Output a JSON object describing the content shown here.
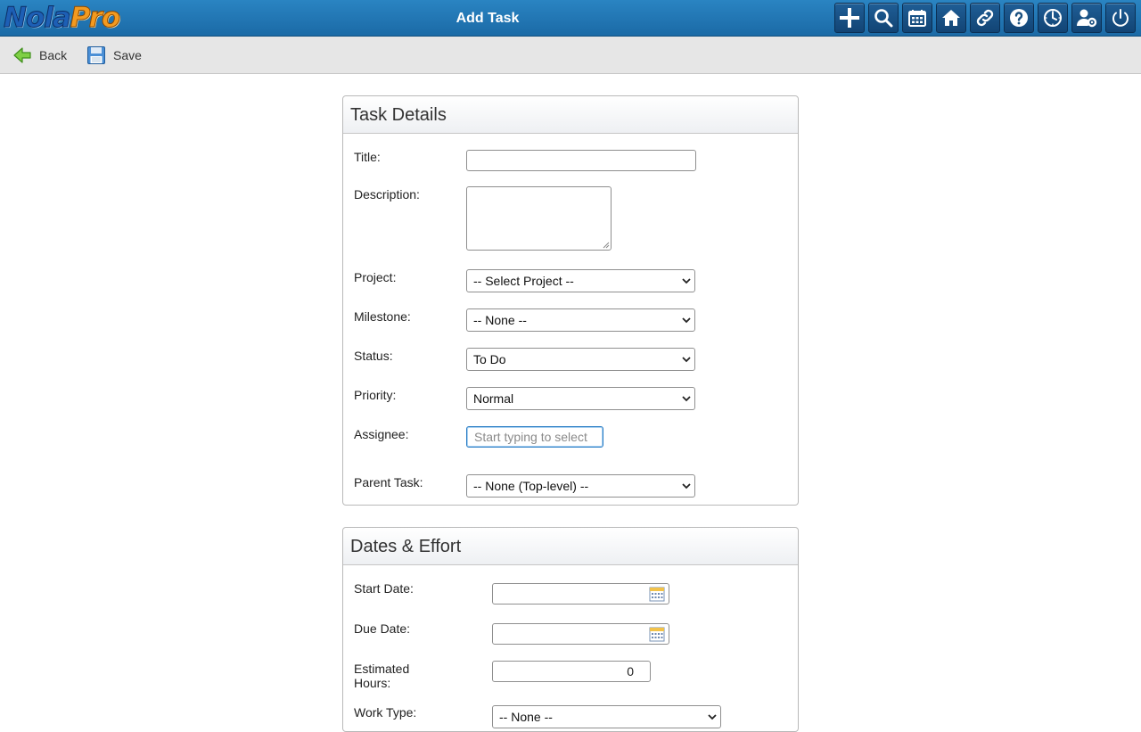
{
  "app": {
    "logo_part1": "Nola",
    "logo_part2": "Pro",
    "title": "Add Task"
  },
  "topbar_icons": [
    "add-icon",
    "search-icon",
    "calendar-icon",
    "home-icon",
    "link-icon",
    "help-icon",
    "clock-icon",
    "user-settings-icon",
    "power-icon"
  ],
  "toolbar": {
    "back_label": "Back",
    "save_label": "Save"
  },
  "task_details": {
    "heading": "Task Details",
    "title_label": "Title:",
    "title_value": "",
    "description_label": "Description:",
    "project_label": "Project:",
    "project_value": "-- Select Project --",
    "milestone_label": "Milestone:",
    "milestone_value": "-- None --",
    "status_label": "Status:",
    "status_value": "To Do",
    "priority_label": "Priority:",
    "priority_value": "Normal",
    "assignee_label": "Assignee:",
    "assignee_placeholder": "Start typing to select",
    "parent_label": "Parent Task:",
    "parent_value": "-- None (Top-level) --"
  },
  "dates_effort": {
    "heading": "Dates & Effort",
    "start_label": "Start Date:",
    "due_label": "Due Date:",
    "est_label_line1": "Estimated",
    "est_label_line2": "Hours:",
    "est_value": "0",
    "worktype_label": "Work Type:",
    "worktype_value": "-- None --"
  },
  "colors": {
    "topbar": "#1f77b8",
    "toolbar": "#e6e6e6",
    "accent_logo_blue": "#1d5fb5",
    "accent_logo_orange": "#f39a1f"
  }
}
